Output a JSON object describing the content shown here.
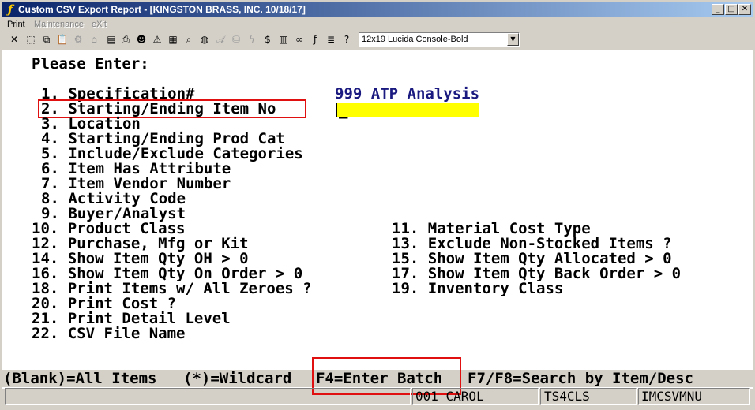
{
  "window": {
    "title": "Custom CSV Export Report - [KINGSTON BRASS, INC. 10/18/17]",
    "caption_min": "_",
    "caption_max": "□",
    "caption_close": "✕"
  },
  "menu": {
    "print": "Print",
    "maintenance": "Maintenance",
    "exit": "eXit"
  },
  "toolbar": {
    "font_select_value": "12x19 Lucida Console-Bold",
    "font_select_arrow": "▼"
  },
  "screen": {
    "heading": "Please Enter:",
    "field_value": "999 ATP Analysis",
    "cursor": "_",
    "options_left": [
      "1. Specification#",
      "2. Starting/Ending Item No",
      "3. Location",
      "4. Starting/Ending Prod Cat",
      "5. Include/Exclude Categories",
      "6. Item Has Attribute",
      "7. Item Vendor Number",
      "8. Activity Code",
      "9. Buyer/Analyst",
      "10. Product Class",
      "12. Purchase, Mfg or Kit",
      "14. Show Item Qty OH > 0",
      "16. Show Item Qty On Order > 0",
      "18. Print Items w/ All Zeroes ?",
      "20. Print Cost ?",
      "21. Print Detail Level",
      "22. CSV File Name"
    ],
    "options_right": [
      "11. Material Cost Type",
      "13. Exclude Non-Stocked Items ?",
      "15. Show Item Qty Allocated > 0",
      "17. Show Item Qty Back Order > 0",
      "19. Inventory Class"
    ],
    "hints": {
      "blank": "(Blank)=All Items",
      "wildcard": "(*)=Wildcard",
      "f4": "F4=Enter Batch",
      "f7f8": "F7/F8=Search by Item/Desc"
    }
  },
  "status": {
    "user": "001 CAROL",
    "terminal": "TS4CLS",
    "program": "IMCSVMNU"
  }
}
